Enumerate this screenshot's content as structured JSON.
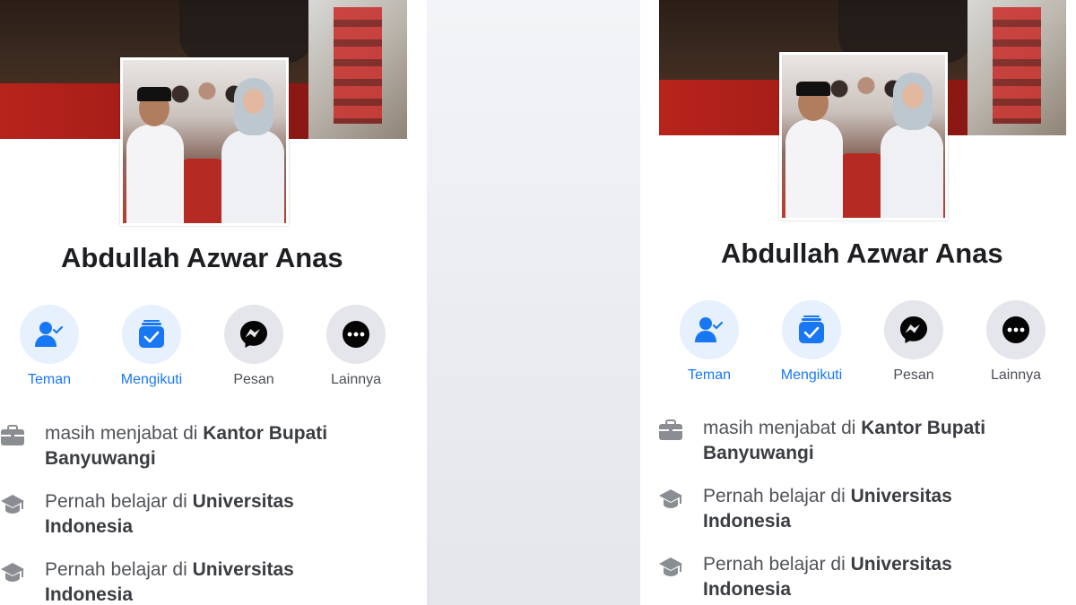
{
  "profile": {
    "name": "Abdullah Azwar Anas"
  },
  "actions": [
    {
      "label": "Teman",
      "icon": "friend-check-icon",
      "style": "blue"
    },
    {
      "label": "Mengikuti",
      "icon": "following-check-icon",
      "style": "blue"
    },
    {
      "label": "Pesan",
      "icon": "messenger-icon",
      "style": "grey"
    },
    {
      "label": "Lainnya",
      "icon": "more-dots-icon",
      "style": "grey"
    }
  ],
  "info": [
    {
      "icon": "briefcase-icon",
      "prefix": "masih menjabat di ",
      "bold_1": "Kantor Bupati",
      "bold_2": "Banyuwangi"
    },
    {
      "icon": "graduation-cap-icon",
      "prefix": "Pernah belajar di ",
      "bold_1": "Universitas",
      "bold_2": "Indonesia"
    },
    {
      "icon": "graduation-cap-icon",
      "prefix": "Pernah belajar di ",
      "bold_1": "Universitas",
      "bold_2": "Indonesia"
    }
  ],
  "colors": {
    "accent": "#1877f2",
    "accent_bg": "#e7f0fd",
    "button_grey": "#e4e6eb",
    "text": "#1c1e21"
  }
}
